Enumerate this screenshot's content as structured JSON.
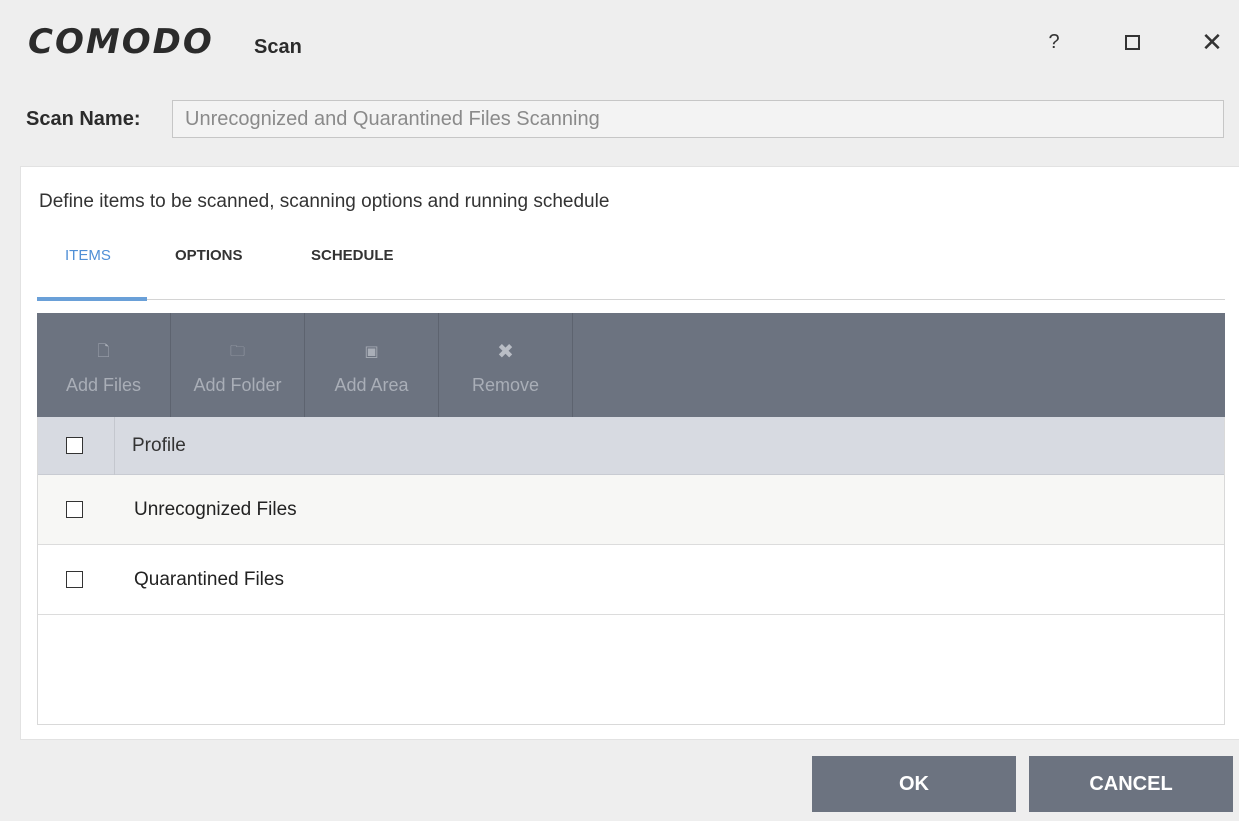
{
  "window": {
    "logo": "COMODO",
    "title": "Scan",
    "controls": {
      "help": "?",
      "close": "✕"
    }
  },
  "scan_name": {
    "label": "Scan Name:",
    "value": "Unrecognized and Quarantined Files Scanning"
  },
  "panel": {
    "description": "Define items to be scanned, scanning options and running schedule",
    "tabs": [
      {
        "label": "ITEMS",
        "active": true
      },
      {
        "label": "OPTIONS",
        "active": false
      },
      {
        "label": "SCHEDULE",
        "active": false
      }
    ]
  },
  "toolbar": {
    "items": [
      {
        "label": "Add Files",
        "icon": "add-file-icon",
        "glyph": "🗋"
      },
      {
        "label": "Add Folder",
        "icon": "add-folder-icon",
        "glyph": "🗀"
      },
      {
        "label": "Add Area",
        "icon": "add-area-icon",
        "glyph": "▣"
      },
      {
        "label": "Remove",
        "icon": "remove-icon",
        "glyph": "✖"
      }
    ]
  },
  "list": {
    "header": "Profile",
    "rows": [
      {
        "label": "Unrecognized Files",
        "checked": false
      },
      {
        "label": "Quarantined Files",
        "checked": false
      }
    ]
  },
  "buttons": {
    "ok": "OK",
    "cancel": "CANCEL"
  },
  "colors": {
    "toolbar": "#6c7380",
    "accent_tab": "#4f8fd6",
    "list_header": "#d7dae1"
  }
}
